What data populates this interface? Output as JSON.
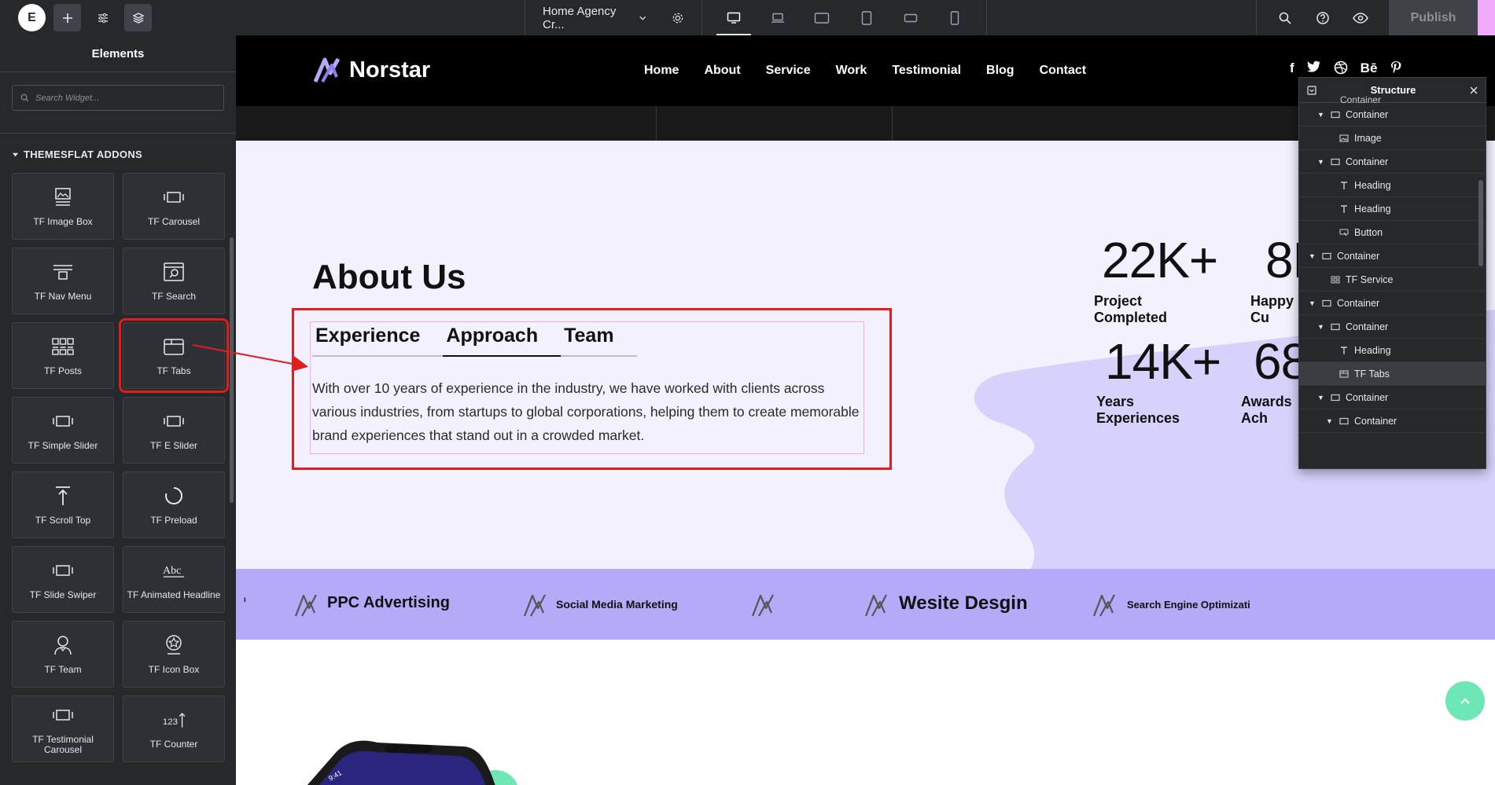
{
  "topbar": {
    "logo": "E",
    "document_title": "Home Agency Cr...",
    "publish_label": "Publish"
  },
  "panel": {
    "title": "Elements",
    "search_placeholder": "Search Widget...",
    "category": "THEMESFLAT ADDONS",
    "widgets": [
      {
        "label": "TF Image Box",
        "icon": "image-box-icon"
      },
      {
        "label": "TF Carousel",
        "icon": "carousel-icon"
      },
      {
        "label": "TF Nav Menu",
        "icon": "nav-menu-icon"
      },
      {
        "label": "TF Search",
        "icon": "search-widget-icon"
      },
      {
        "label": "TF Posts",
        "icon": "posts-icon"
      },
      {
        "label": "TF Tabs",
        "icon": "tabs-icon"
      },
      {
        "label": "TF Simple Slider",
        "icon": "slider-icon"
      },
      {
        "label": "TF E Slider",
        "icon": "slider-icon"
      },
      {
        "label": "TF Scroll Top",
        "icon": "scroll-top-icon"
      },
      {
        "label": "TF Preload",
        "icon": "preload-icon"
      },
      {
        "label": "TF Slide Swiper",
        "icon": "slider-icon"
      },
      {
        "label": "TF Animated Headline",
        "icon": "animated-headline-icon"
      },
      {
        "label": "TF Team",
        "icon": "team-icon"
      },
      {
        "label": "TF Icon Box",
        "icon": "icon-box-icon"
      },
      {
        "label": "TF Testimonial Carousel",
        "icon": "slider-icon"
      },
      {
        "label": "TF Counter",
        "icon": "counter-icon"
      }
    ]
  },
  "site": {
    "brand": "Norstar",
    "nav": [
      "Home",
      "About",
      "Service",
      "Work",
      "Testimonial",
      "Blog",
      "Contact"
    ],
    "socials": [
      "f",
      "t",
      "dribbble",
      "Bē",
      "p"
    ],
    "about_title": "About Us",
    "tabs": [
      {
        "label": "Experience",
        "active": false
      },
      {
        "label": "Approach",
        "active": true
      },
      {
        "label": "Team",
        "active": false
      }
    ],
    "tab_text": "With over 10 years of experience in the industry, we have worked with clients across various industries, from startups to global corporations, helping them to create memorable brand experiences that stand out in a crowded market.",
    "stats": [
      {
        "num": "22K+",
        "label": "Project Completed"
      },
      {
        "num": "8K",
        "label": "Happy Cu"
      },
      {
        "num": "14K+",
        "label": "Years Experiences"
      },
      {
        "num": "68",
        "label": "Awards Ach"
      }
    ],
    "marquee": [
      "PPC Advertising",
      "Social Media Marketing",
      "Wesite Desgin",
      "Search Engine Optimizati"
    ],
    "phone_time": "9:41"
  },
  "structure": {
    "title": "Structure",
    "top_partial": "Container",
    "rows": [
      {
        "label": "Container",
        "indent": 1,
        "caret": true,
        "icon": "container-icon"
      },
      {
        "label": "Image",
        "indent": 2,
        "caret": false,
        "icon": "image-icon"
      },
      {
        "label": "Container",
        "indent": 1,
        "caret": true,
        "icon": "container-icon"
      },
      {
        "label": "Heading",
        "indent": 2,
        "caret": false,
        "icon": "heading-icon"
      },
      {
        "label": "Heading",
        "indent": 2,
        "caret": false,
        "icon": "heading-icon"
      },
      {
        "label": "Button",
        "indent": 2,
        "caret": false,
        "icon": "button-icon"
      },
      {
        "label": "Container",
        "indent": 0,
        "caret": true,
        "icon": "container-icon"
      },
      {
        "label": "TF Service",
        "indent": 1,
        "caret": false,
        "icon": "grid-icon"
      },
      {
        "label": "Container",
        "indent": 0,
        "caret": true,
        "icon": "container-icon"
      },
      {
        "label": "Container",
        "indent": 1,
        "caret": true,
        "icon": "container-icon"
      },
      {
        "label": "Heading",
        "indent": 2,
        "caret": false,
        "icon": "heading-icon"
      },
      {
        "label": "TF Tabs",
        "indent": 2,
        "caret": false,
        "icon": "tabs-icon",
        "selected": true
      },
      {
        "label": "Container",
        "indent": 1,
        "caret": true,
        "icon": "container-icon"
      },
      {
        "label": "Container",
        "indent": 2,
        "caret": true,
        "icon": "container-icon"
      }
    ]
  },
  "colors": {
    "accent_red": "#e11d1d",
    "marquee_bg": "#b3aaf8",
    "section_bg": "#f3f1fd",
    "scroll_top": "#6ee7b7"
  }
}
